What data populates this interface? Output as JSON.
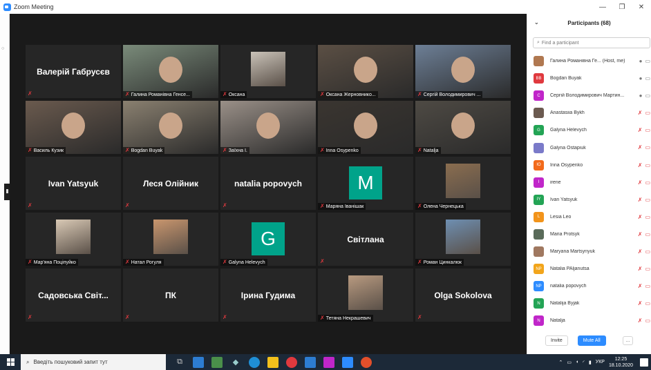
{
  "window": {
    "title": "Zoom Meeting",
    "minimize": "—",
    "restore": "❐",
    "close": "✕"
  },
  "tiles": [
    {
      "big": "Валерій Габрусєв",
      "label": "",
      "kind": "name"
    },
    {
      "big": "",
      "label": "Галина Романівна Генсе...",
      "kind": "video",
      "bg": "#7a8b7a"
    },
    {
      "big": "",
      "label": "Оксана",
      "kind": "thumb",
      "bg": "#c9c2b8"
    },
    {
      "big": "",
      "label": "Оксана Жерновнико...",
      "kind": "video",
      "bg": "#5b4f44"
    },
    {
      "big": "",
      "label": "Сергій Володимирович ...",
      "kind": "video",
      "bg": "#6d7f96"
    },
    {
      "big": "",
      "label": "Василь Кузик",
      "kind": "video",
      "bg": "#6a5a4e"
    },
    {
      "big": "",
      "label": "Bogdan Buyak",
      "kind": "video",
      "bg": "#8a8070",
      "active": true
    },
    {
      "big": "",
      "label": "Заїхна І.",
      "kind": "video",
      "bg": "#9a9088"
    },
    {
      "big": "",
      "label": "Inna Osypenko",
      "kind": "video",
      "bg": "#3a3530"
    },
    {
      "big": "",
      "label": "Natalja",
      "kind": "video",
      "bg": "#4e4a44"
    },
    {
      "big": "Ivan Yatsyuk",
      "label": "",
      "kind": "name"
    },
    {
      "big": "Леся Олійник",
      "label": "",
      "kind": "name"
    },
    {
      "big": "natalia popovych",
      "label": "",
      "kind": "name"
    },
    {
      "big": "",
      "label": "Маряна Іванішак",
      "kind": "letter",
      "letter": "M"
    },
    {
      "big": "",
      "label": "Олена Чернецька",
      "kind": "thumb",
      "bg": "#8a6d4f"
    },
    {
      "big": "",
      "label": "Мар'яна Поціпуйко",
      "kind": "thumb",
      "bg": "#d9c9b5"
    },
    {
      "big": "",
      "label": "Натал Рогуля",
      "kind": "thumb",
      "bg": "#c9966e"
    },
    {
      "big": "",
      "label": "Galyna Helevych",
      "kind": "letter",
      "letter": "G"
    },
    {
      "big": "Світлана",
      "label": "",
      "kind": "name"
    },
    {
      "big": "",
      "label": "Роман Цинкалюк",
      "kind": "thumb",
      "bg": "#6e8fb2"
    },
    {
      "big": "Садовська Світ...",
      "label": "",
      "kind": "name"
    },
    {
      "big": "ПК",
      "label": "",
      "kind": "name"
    },
    {
      "big": "Ірина Гудима",
      "label": "",
      "kind": "name"
    },
    {
      "big": "",
      "label": "Тетяна Некрашевич",
      "kind": "thumb",
      "bg": "#b89a80"
    },
    {
      "big": "Olga Sokolova",
      "label": "",
      "kind": "name"
    }
  ],
  "panel": {
    "title": "Participants (68)",
    "search_placeholder": "Find a participant",
    "participants": [
      {
        "name": "Галина Романівна Ге...  (Host, me)",
        "initials": "",
        "color": "#b07850",
        "mic": "on"
      },
      {
        "name": "Bogdan Buyak",
        "initials": "BB",
        "color": "#e0393e",
        "mic": "on"
      },
      {
        "name": "Сергій Володимирович Мартин...",
        "initials": "С",
        "color": "#c026c9",
        "mic": "on"
      },
      {
        "name": "Anastasiia Bykh",
        "initials": "",
        "color": "#6b5a50",
        "mic": "off"
      },
      {
        "name": "Galyna Helevych",
        "initials": "G",
        "color": "#23a455",
        "mic": "off"
      },
      {
        "name": "Galyna Ostapiuk",
        "initials": "",
        "color": "#7a7ac9",
        "mic": "off"
      },
      {
        "name": "Inna Osypenko",
        "initials": "IO",
        "color": "#f26a1b",
        "mic": "off"
      },
      {
        "name": "irene",
        "initials": "I",
        "color": "#c026c9",
        "mic": "off"
      },
      {
        "name": "Ivan Yatsyuk",
        "initials": "IY",
        "color": "#23a455",
        "mic": "off"
      },
      {
        "name": "Lesia Leo",
        "initials": "L",
        "color": "#f2941b",
        "mic": "off"
      },
      {
        "name": "Maria Protsyk",
        "initials": "",
        "color": "#5a6b5a",
        "mic": "off"
      },
      {
        "name": "Maryana Martsynyuk",
        "initials": "",
        "color": "#a07860",
        "mic": "off"
      },
      {
        "name": "Natalia  PAljanutsa",
        "initials": "NP",
        "color": "#f2a51b",
        "mic": "off"
      },
      {
        "name": "natalia popovych",
        "initials": "NP",
        "color": "#2d8cff",
        "mic": "off"
      },
      {
        "name": "Natalija Byjak",
        "initials": "N",
        "color": "#23a455",
        "mic": "off"
      },
      {
        "name": "Natalja",
        "initials": "N",
        "color": "#c026c9",
        "mic": "off"
      }
    ],
    "invite": "Invite",
    "mute_all": "Mute All",
    "more": "..."
  },
  "taskbar": {
    "search_placeholder": "Введіть пошуковий запит тут",
    "lang": "УКР",
    "time": "12:25",
    "date": "18.10.2020"
  }
}
